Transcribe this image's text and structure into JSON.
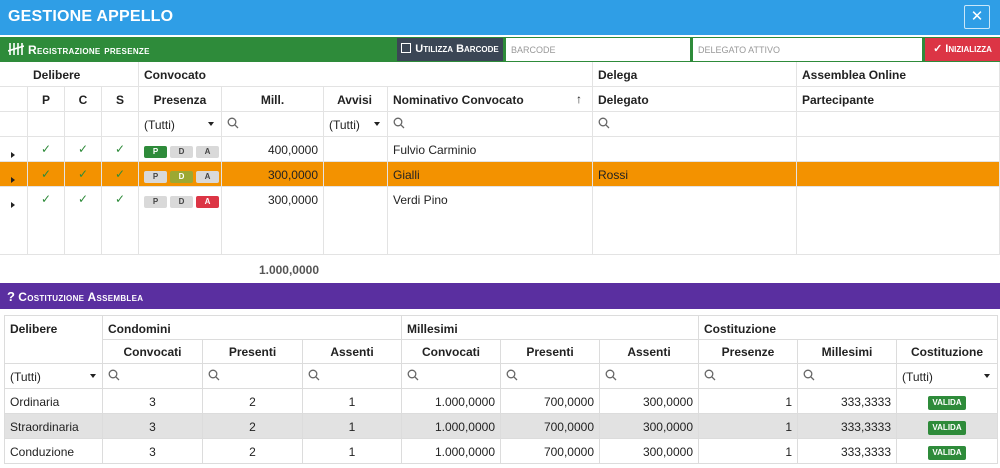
{
  "window": {
    "title": "GESTIONE APPELLO",
    "close_label": "✕"
  },
  "registration": {
    "title": "Registrazione presenze",
    "barcode_button": "Utilizza Barcode",
    "barcode_placeholder": "BARCODE",
    "delegate_placeholder": "DELEGATO ATTIVO",
    "init_button": "Inizializza"
  },
  "grid1": {
    "group_headers": {
      "delibere": "Delibere",
      "convocato": "Convocato",
      "delega": "Delega",
      "assemblea_online": "Assemblea Online"
    },
    "columns": {
      "p": "P",
      "c": "C",
      "s": "S",
      "presenza": "Presenza",
      "mill": "Mill.",
      "avvisi": "Avvisi",
      "nominativo": "Nominativo Convocato",
      "sort_arrow": "↑",
      "delegato": "Delegato",
      "partecipante": "Partecipante"
    },
    "filters": {
      "presenza": "(Tutti)",
      "avvisi": "(Tutti)"
    },
    "rows": [
      {
        "mill": "400,0000",
        "nominativo": "Fulvio Carminio",
        "delegato": "",
        "presence": "P"
      },
      {
        "mill": "300,0000",
        "nominativo": "Gialli",
        "delegato": "Rossi",
        "presence": "D"
      },
      {
        "mill": "300,0000",
        "nominativo": "Verdi Pino",
        "delegato": "",
        "presence": "A"
      }
    ],
    "badge_labels": {
      "p": "P",
      "d": "D",
      "a": "A"
    },
    "total_mill": "1.000,0000",
    "highlight_color": "#f39200"
  },
  "costituzione": {
    "title": "Costituzione Assemblea",
    "group_headers": {
      "delibere": "Delibere",
      "condomini": "Condomini",
      "millesimi": "Millesimi",
      "costituzione": "Costituzione"
    },
    "columns": {
      "convocati": "Convocati",
      "presenti": "Presenti",
      "assenti": "Assenti",
      "m_convocati": "Convocati",
      "m_presenti": "Presenti",
      "m_assenti": "Assenti",
      "presenze": "Presenze",
      "millesimi": "Millesimi",
      "costituzione": "Costituzione"
    },
    "filters": {
      "delibere": "(Tutti)",
      "costituzione": "(Tutti)"
    },
    "rows": [
      {
        "delibera": "Ordinaria",
        "convocati": "3",
        "presenti": "2",
        "assenti": "1",
        "m_convocati": "1.000,0000",
        "m_presenti": "700,0000",
        "m_assenti": "300,0000",
        "presenze": "1",
        "millesimi": "333,3333",
        "stato": "VALIDA"
      },
      {
        "delibera": "Straordinaria",
        "convocati": "3",
        "presenti": "2",
        "assenti": "1",
        "m_convocati": "1.000,0000",
        "m_presenti": "700,0000",
        "m_assenti": "300,0000",
        "presenze": "1",
        "millesimi": "333,3333",
        "stato": "VALIDA"
      },
      {
        "delibera": "Conduzione",
        "convocati": "3",
        "presenti": "2",
        "assenti": "1",
        "m_convocati": "1.000,0000",
        "m_presenti": "700,0000",
        "m_assenti": "300,0000",
        "presenze": "1",
        "millesimi": "333,3333",
        "stato": "VALIDA"
      }
    ]
  },
  "colors": {
    "title_bar": "#2f9ee6",
    "registration_bar": "#2e8b3a",
    "barcode_button": "#3b4655",
    "init_button": "#dc3545",
    "costituzione_bar": "#5a2fa0",
    "valida_badge": "#2e8b3a"
  }
}
